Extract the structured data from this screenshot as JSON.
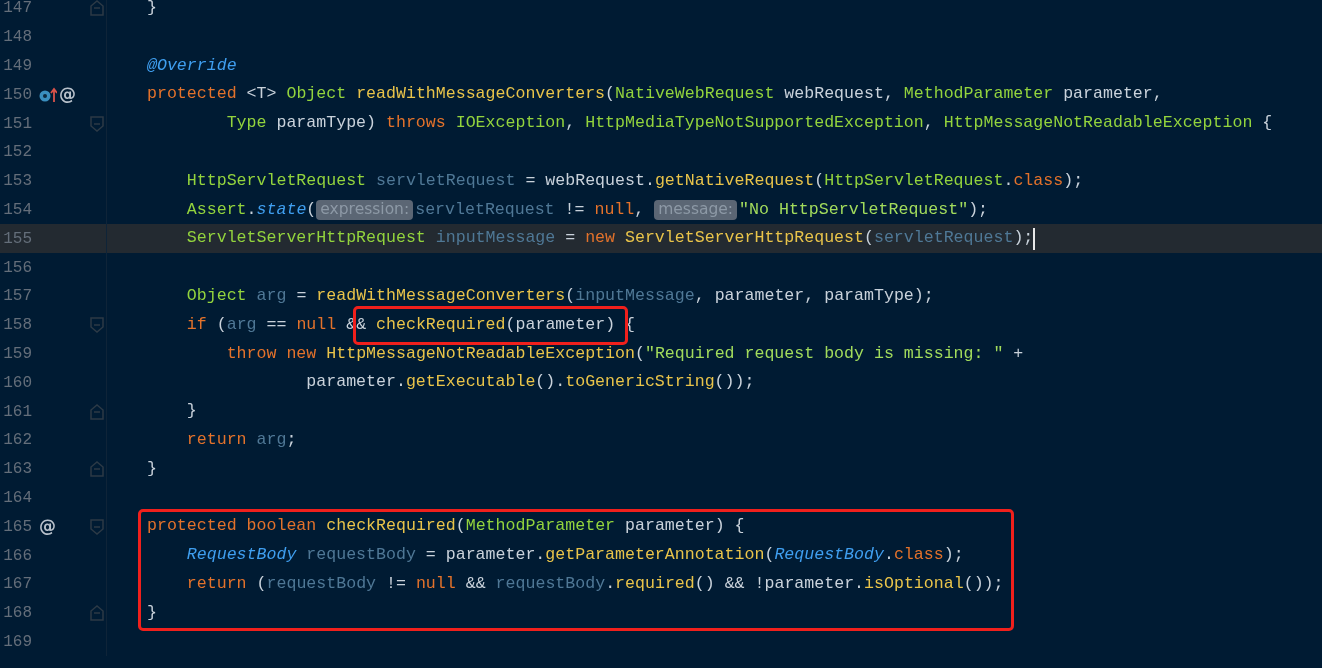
{
  "editor": {
    "lines": [
      {
        "number": "147",
        "current": false,
        "boxed": false,
        "gutter": [
          {
            "kind": "fold-end"
          }
        ],
        "tokens": [
          {
            "kind": "plain",
            "text": "}"
          }
        ]
      },
      {
        "number": "148",
        "current": false,
        "boxed": false
      },
      {
        "number": "149",
        "current": false,
        "boxed": false,
        "tokens": [
          {
            "kind": "annotation",
            "text": "@Override"
          }
        ]
      },
      {
        "number": "150",
        "current": false,
        "boxed": false,
        "gutter": [
          {
            "kind": "override"
          },
          {
            "kind": "symbol",
            "text": "@"
          }
        ],
        "tokens": [
          {
            "kind": "keyword",
            "text": "protected"
          },
          {
            "kind": "plain",
            "text": " <T> "
          },
          {
            "kind": "type",
            "text": "Object"
          },
          {
            "kind": "method",
            "text": " readWithMessageConverters"
          },
          {
            "kind": "plain",
            "text": "("
          },
          {
            "kind": "type",
            "text": "NativeWebRequest"
          },
          {
            "kind": "plain",
            "text": " webRequest, "
          },
          {
            "kind": "type",
            "text": "MethodParameter"
          },
          {
            "kind": "plain",
            "text": " parameter,"
          }
        ]
      },
      {
        "number": "151",
        "current": false,
        "boxed": false,
        "gutter": [
          {
            "kind": "fold-start"
          }
        ],
        "tokens": [
          {
            "kind": "type",
            "text": "        Type"
          },
          {
            "kind": "plain",
            "text": " paramType) "
          },
          {
            "kind": "keyword",
            "text": "throws"
          },
          {
            "kind": "type",
            "text": " IOException"
          },
          {
            "kind": "plain",
            "text": ", "
          },
          {
            "kind": "type",
            "text": "HttpMediaTypeNotSupportedException"
          },
          {
            "kind": "plain",
            "text": ", "
          },
          {
            "kind": "type",
            "text": "HttpMessageNotReadableException"
          },
          {
            "kind": "plain",
            "text": " {"
          }
        ]
      },
      {
        "number": "152",
        "current": false,
        "boxed": false
      },
      {
        "number": "153",
        "current": false,
        "boxed": false,
        "tokens": [
          {
            "kind": "type",
            "text": "    HttpServletRequest"
          },
          {
            "kind": "local",
            "text": " servletRequest"
          },
          {
            "kind": "plain",
            "text": " = webRequest."
          },
          {
            "kind": "method",
            "text": "getNativeRequest"
          },
          {
            "kind": "plain",
            "text": "("
          },
          {
            "kind": "type",
            "text": "HttpServletRequest"
          },
          {
            "kind": "plain",
            "text": "."
          },
          {
            "kind": "keyword",
            "text": "class"
          },
          {
            "kind": "plain",
            "text": ");"
          }
        ]
      },
      {
        "number": "154",
        "current": false,
        "boxed": false,
        "tokens": [
          {
            "kind": "type",
            "text": "    Assert"
          },
          {
            "kind": "plain",
            "text": "."
          },
          {
            "kind": "annotation",
            "text": "state"
          },
          {
            "kind": "plain",
            "text": "("
          },
          {
            "kind": "hint",
            "text": "expression:"
          },
          {
            "kind": "local",
            "text": "servletRequest"
          },
          {
            "kind": "plain",
            "text": " != "
          },
          {
            "kind": "keyword",
            "text": "null"
          },
          {
            "kind": "plain",
            "text": ", "
          },
          {
            "kind": "hint",
            "text": "message:"
          },
          {
            "kind": "string",
            "text": "\"No HttpServletRequest\""
          },
          {
            "kind": "plain",
            "text": ");"
          }
        ]
      },
      {
        "number": "155",
        "current": true,
        "boxed": false,
        "caret": true,
        "tokens": [
          {
            "kind": "type",
            "text": "    ServletServerHttpRequest"
          },
          {
            "kind": "local",
            "text": " inputMessage"
          },
          {
            "kind": "plain",
            "text": " = "
          },
          {
            "kind": "keyword",
            "text": "new"
          },
          {
            "kind": "method",
            "text": " ServletServerHttpRequest"
          },
          {
            "kind": "plain",
            "text": "("
          },
          {
            "kind": "local",
            "text": "servletRequest"
          },
          {
            "kind": "plain",
            "text": ");"
          }
        ]
      },
      {
        "number": "156",
        "current": false,
        "boxed": false
      },
      {
        "number": "157",
        "current": false,
        "boxed": false,
        "tokens": [
          {
            "kind": "type",
            "text": "    Object"
          },
          {
            "kind": "local",
            "text": " arg"
          },
          {
            "kind": "plain",
            "text": " = "
          },
          {
            "kind": "method",
            "text": "readWithMessageConverters"
          },
          {
            "kind": "plain",
            "text": "("
          },
          {
            "kind": "local",
            "text": "inputMessage"
          },
          {
            "kind": "plain",
            "text": ", parameter, paramType);"
          }
        ]
      },
      {
        "number": "158",
        "current": false,
        "boxed": false,
        "gutter": [
          {
            "kind": "fold-start"
          }
        ],
        "tokens": [
          {
            "kind": "keyword",
            "text": "    if"
          },
          {
            "kind": "plain",
            "text": " ("
          },
          {
            "kind": "local",
            "text": "arg"
          },
          {
            "kind": "plain",
            "text": " == "
          },
          {
            "kind": "keyword",
            "text": "null"
          },
          {
            "kind": "plain",
            "text": " &"
          },
          {
            "kind": "plain",
            "text": "&",
            "boxed": true
          },
          {
            "kind": "method",
            "text": " checkRequired",
            "boxed": true
          },
          {
            "kind": "plain",
            "text": "(parameter)",
            "boxed": true
          },
          {
            "kind": "plain",
            "text": " {"
          }
        ]
      },
      {
        "number": "159",
        "current": false,
        "boxed": false,
        "tokens": [
          {
            "kind": "keyword",
            "text": "        throw"
          },
          {
            "kind": "keyword",
            "text": " new"
          },
          {
            "kind": "method",
            "text": " HttpMessageNotReadableException"
          },
          {
            "kind": "plain",
            "text": "("
          },
          {
            "kind": "string",
            "text": "\"Required request body is missing: \""
          },
          {
            "kind": "plain",
            "text": " +"
          }
        ]
      },
      {
        "number": "160",
        "current": false,
        "boxed": false,
        "tokens": [
          {
            "kind": "plain",
            "text": "                parameter."
          },
          {
            "kind": "method",
            "text": "getExecutable"
          },
          {
            "kind": "plain",
            "text": "()."
          },
          {
            "kind": "method",
            "text": "toGenericString"
          },
          {
            "kind": "plain",
            "text": "());"
          }
        ]
      },
      {
        "number": "161",
        "current": false,
        "boxed": false,
        "gutter": [
          {
            "kind": "fold-end"
          }
        ],
        "tokens": [
          {
            "kind": "plain",
            "text": "    }"
          }
        ]
      },
      {
        "number": "162",
        "current": false,
        "boxed": false,
        "tokens": [
          {
            "kind": "keyword",
            "text": "    return"
          },
          {
            "kind": "local",
            "text": " arg"
          },
          {
            "kind": "plain",
            "text": ";"
          }
        ]
      },
      {
        "number": "163",
        "current": false,
        "boxed": false,
        "gutter": [
          {
            "kind": "fold-end"
          }
        ],
        "tokens": [
          {
            "kind": "plain",
            "text": "}"
          }
        ]
      },
      {
        "number": "164",
        "current": false,
        "boxed": false
      },
      {
        "number": "165",
        "current": false,
        "boxed": true,
        "gutter": [
          {
            "kind": "symbol",
            "text": "@"
          },
          {
            "kind": "fold-start"
          }
        ],
        "tokens": [
          {
            "kind": "keyword",
            "text": "protected"
          },
          {
            "kind": "keyword",
            "text": " boolean"
          },
          {
            "kind": "method",
            "text": " checkRequired"
          },
          {
            "kind": "plain",
            "text": "("
          },
          {
            "kind": "type",
            "text": "MethodParameter"
          },
          {
            "kind": "plain",
            "text": " parameter) {"
          }
        ]
      },
      {
        "number": "166",
        "current": false,
        "boxed": true,
        "tokens": [
          {
            "kind": "annotation",
            "text": "    RequestBody"
          },
          {
            "kind": "local",
            "text": " requestBody"
          },
          {
            "kind": "plain",
            "text": " = parameter."
          },
          {
            "kind": "method",
            "text": "getParameterAnnotation"
          },
          {
            "kind": "plain",
            "text": "("
          },
          {
            "kind": "annotation",
            "text": "RequestBody"
          },
          {
            "kind": "plain",
            "text": "."
          },
          {
            "kind": "keyword",
            "text": "class"
          },
          {
            "kind": "plain",
            "text": ");"
          }
        ]
      },
      {
        "number": "167",
        "current": false,
        "boxed": true,
        "tokens": [
          {
            "kind": "keyword",
            "text": "    return"
          },
          {
            "kind": "plain",
            "text": " ("
          },
          {
            "kind": "local",
            "text": "requestBody"
          },
          {
            "kind": "plain",
            "text": " != "
          },
          {
            "kind": "keyword",
            "text": "null"
          },
          {
            "kind": "plain",
            "text": " && "
          },
          {
            "kind": "local",
            "text": "requestBody"
          },
          {
            "kind": "plain",
            "text": "."
          },
          {
            "kind": "method",
            "text": "required"
          },
          {
            "kind": "plain",
            "text": "() && !parameter."
          },
          {
            "kind": "method",
            "text": "isOptional"
          },
          {
            "kind": "plain",
            "text": "());"
          }
        ]
      },
      {
        "number": "168",
        "current": false,
        "boxed": true,
        "gutter": [
          {
            "kind": "fold-end"
          }
        ],
        "tokens": [
          {
            "kind": "plain",
            "text": "}"
          }
        ]
      },
      {
        "number": "169",
        "current": false,
        "boxed": false
      }
    ]
  }
}
